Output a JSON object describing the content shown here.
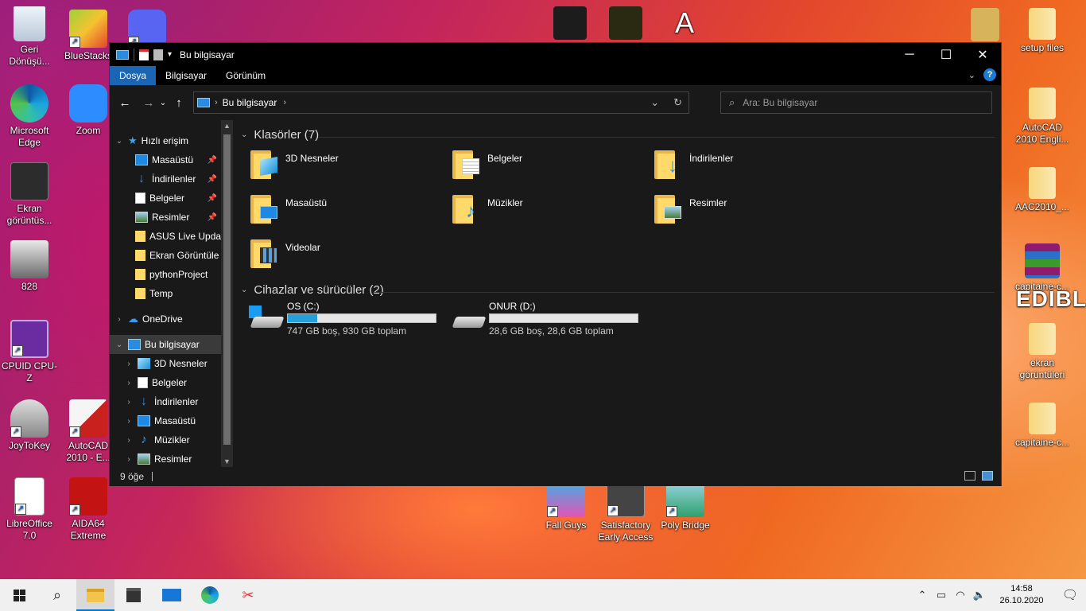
{
  "desktop": {
    "icons_left": [
      {
        "label": "Geri Dönüşü...",
        "icon": "recycle-bin-icon"
      },
      {
        "label": "BlueStacks",
        "icon": "bluestacks-icon"
      },
      {
        "label": "Discord",
        "icon": "discord-icon"
      },
      {
        "label": "Microsoft Edge",
        "icon": "edge-icon"
      },
      {
        "label": "Zoom",
        "icon": "zoom-icon"
      },
      {
        "label": "Ekran görüntüs...",
        "icon": "screenshot-icon"
      },
      {
        "label": "828",
        "icon": "image-icon"
      },
      {
        "label": "CPUID CPU-Z",
        "icon": "cpuz-icon"
      },
      {
        "label": "JoyToKey",
        "icon": "joystick-icon"
      },
      {
        "label": "AutoCAD 2010 - E...",
        "icon": "autocad-icon"
      },
      {
        "label": "LibreOffice 7.0",
        "icon": "libreoffice-icon"
      },
      {
        "label": "AIDA64 Extreme",
        "icon": "aida64-icon"
      }
    ],
    "icons_right": [
      {
        "label": "setup files",
        "icon": "zip-folder-icon"
      },
      {
        "label": "AutoCAD 2010 Engli...",
        "icon": "zip-folder-icon"
      },
      {
        "label": "AAC2010_...",
        "icon": "zip-folder-icon"
      },
      {
        "label": "capitaine-c...",
        "icon": "winrar-icon"
      },
      {
        "label": "ekran görüntüleri",
        "icon": "zip-folder-icon"
      },
      {
        "label": "capitaine-c...",
        "icon": "zip-folder-icon"
      }
    ],
    "icons_bottom": [
      {
        "label": "Fall Guys",
        "icon": "fallguys-icon"
      },
      {
        "label": "Satisfactory Early Access",
        "icon": "satisfactory-icon"
      },
      {
        "label": "Poly Bridge",
        "icon": "polybridge-icon"
      }
    ],
    "wallpaper_text": "EDIBLE"
  },
  "window": {
    "title": "Bu bilgisayar",
    "ribbon_tabs": [
      "Dosya",
      "Bilgisayar",
      "Görünüm"
    ],
    "address": {
      "crumb": "Bu bilgisayar"
    },
    "search": {
      "placeholder": "Ara: Bu bilgisayar"
    },
    "nav": {
      "quick_access": "Hızlı erişim",
      "quick_items": [
        {
          "label": "Masaüstü",
          "pinned": true
        },
        {
          "label": "İndirilenler",
          "pinned": true
        },
        {
          "label": "Belgeler",
          "pinned": true
        },
        {
          "label": "Resimler",
          "pinned": true
        },
        {
          "label": "ASUS Live Updat",
          "pinned": false
        },
        {
          "label": "Ekran Görüntüle",
          "pinned": false
        },
        {
          "label": "pythonProject",
          "pinned": false
        },
        {
          "label": "Temp",
          "pinned": false
        }
      ],
      "onedrive": "OneDrive",
      "this_pc": "Bu bilgisayar",
      "pc_items": [
        "3D Nesneler",
        "Belgeler",
        "İndirilenler",
        "Masaüstü",
        "Müzikler",
        "Resimler"
      ]
    },
    "folders_header": "Klasörler (7)",
    "folders": [
      {
        "name": "3D Nesneler",
        "icon": "3d-objects-icon"
      },
      {
        "name": "Belgeler",
        "icon": "documents-icon"
      },
      {
        "name": "İndirilenler",
        "icon": "downloads-icon"
      },
      {
        "name": "Masaüstü",
        "icon": "desktop-icon"
      },
      {
        "name": "Müzikler",
        "icon": "music-icon"
      },
      {
        "name": "Resimler",
        "icon": "pictures-icon"
      },
      {
        "name": "Videolar",
        "icon": "videos-icon"
      }
    ],
    "drives_header": "Cihazlar ve sürücüler (2)",
    "drives": [
      {
        "name": "OS (C:)",
        "info": "747 GB boş, 930 GB toplam",
        "used_fraction": 0.197
      },
      {
        "name": "ONUR (D:)",
        "info": "28,6 GB boş, 28,6 GB toplam",
        "used_fraction": 0.0
      }
    ],
    "status": "9 öğe"
  },
  "taskbar": {
    "time": "14:58",
    "date": "26.10.2020"
  },
  "colors": {
    "accent": "#1a66b5",
    "drive_fill": "#26a0da",
    "folder": "#ffd969"
  }
}
